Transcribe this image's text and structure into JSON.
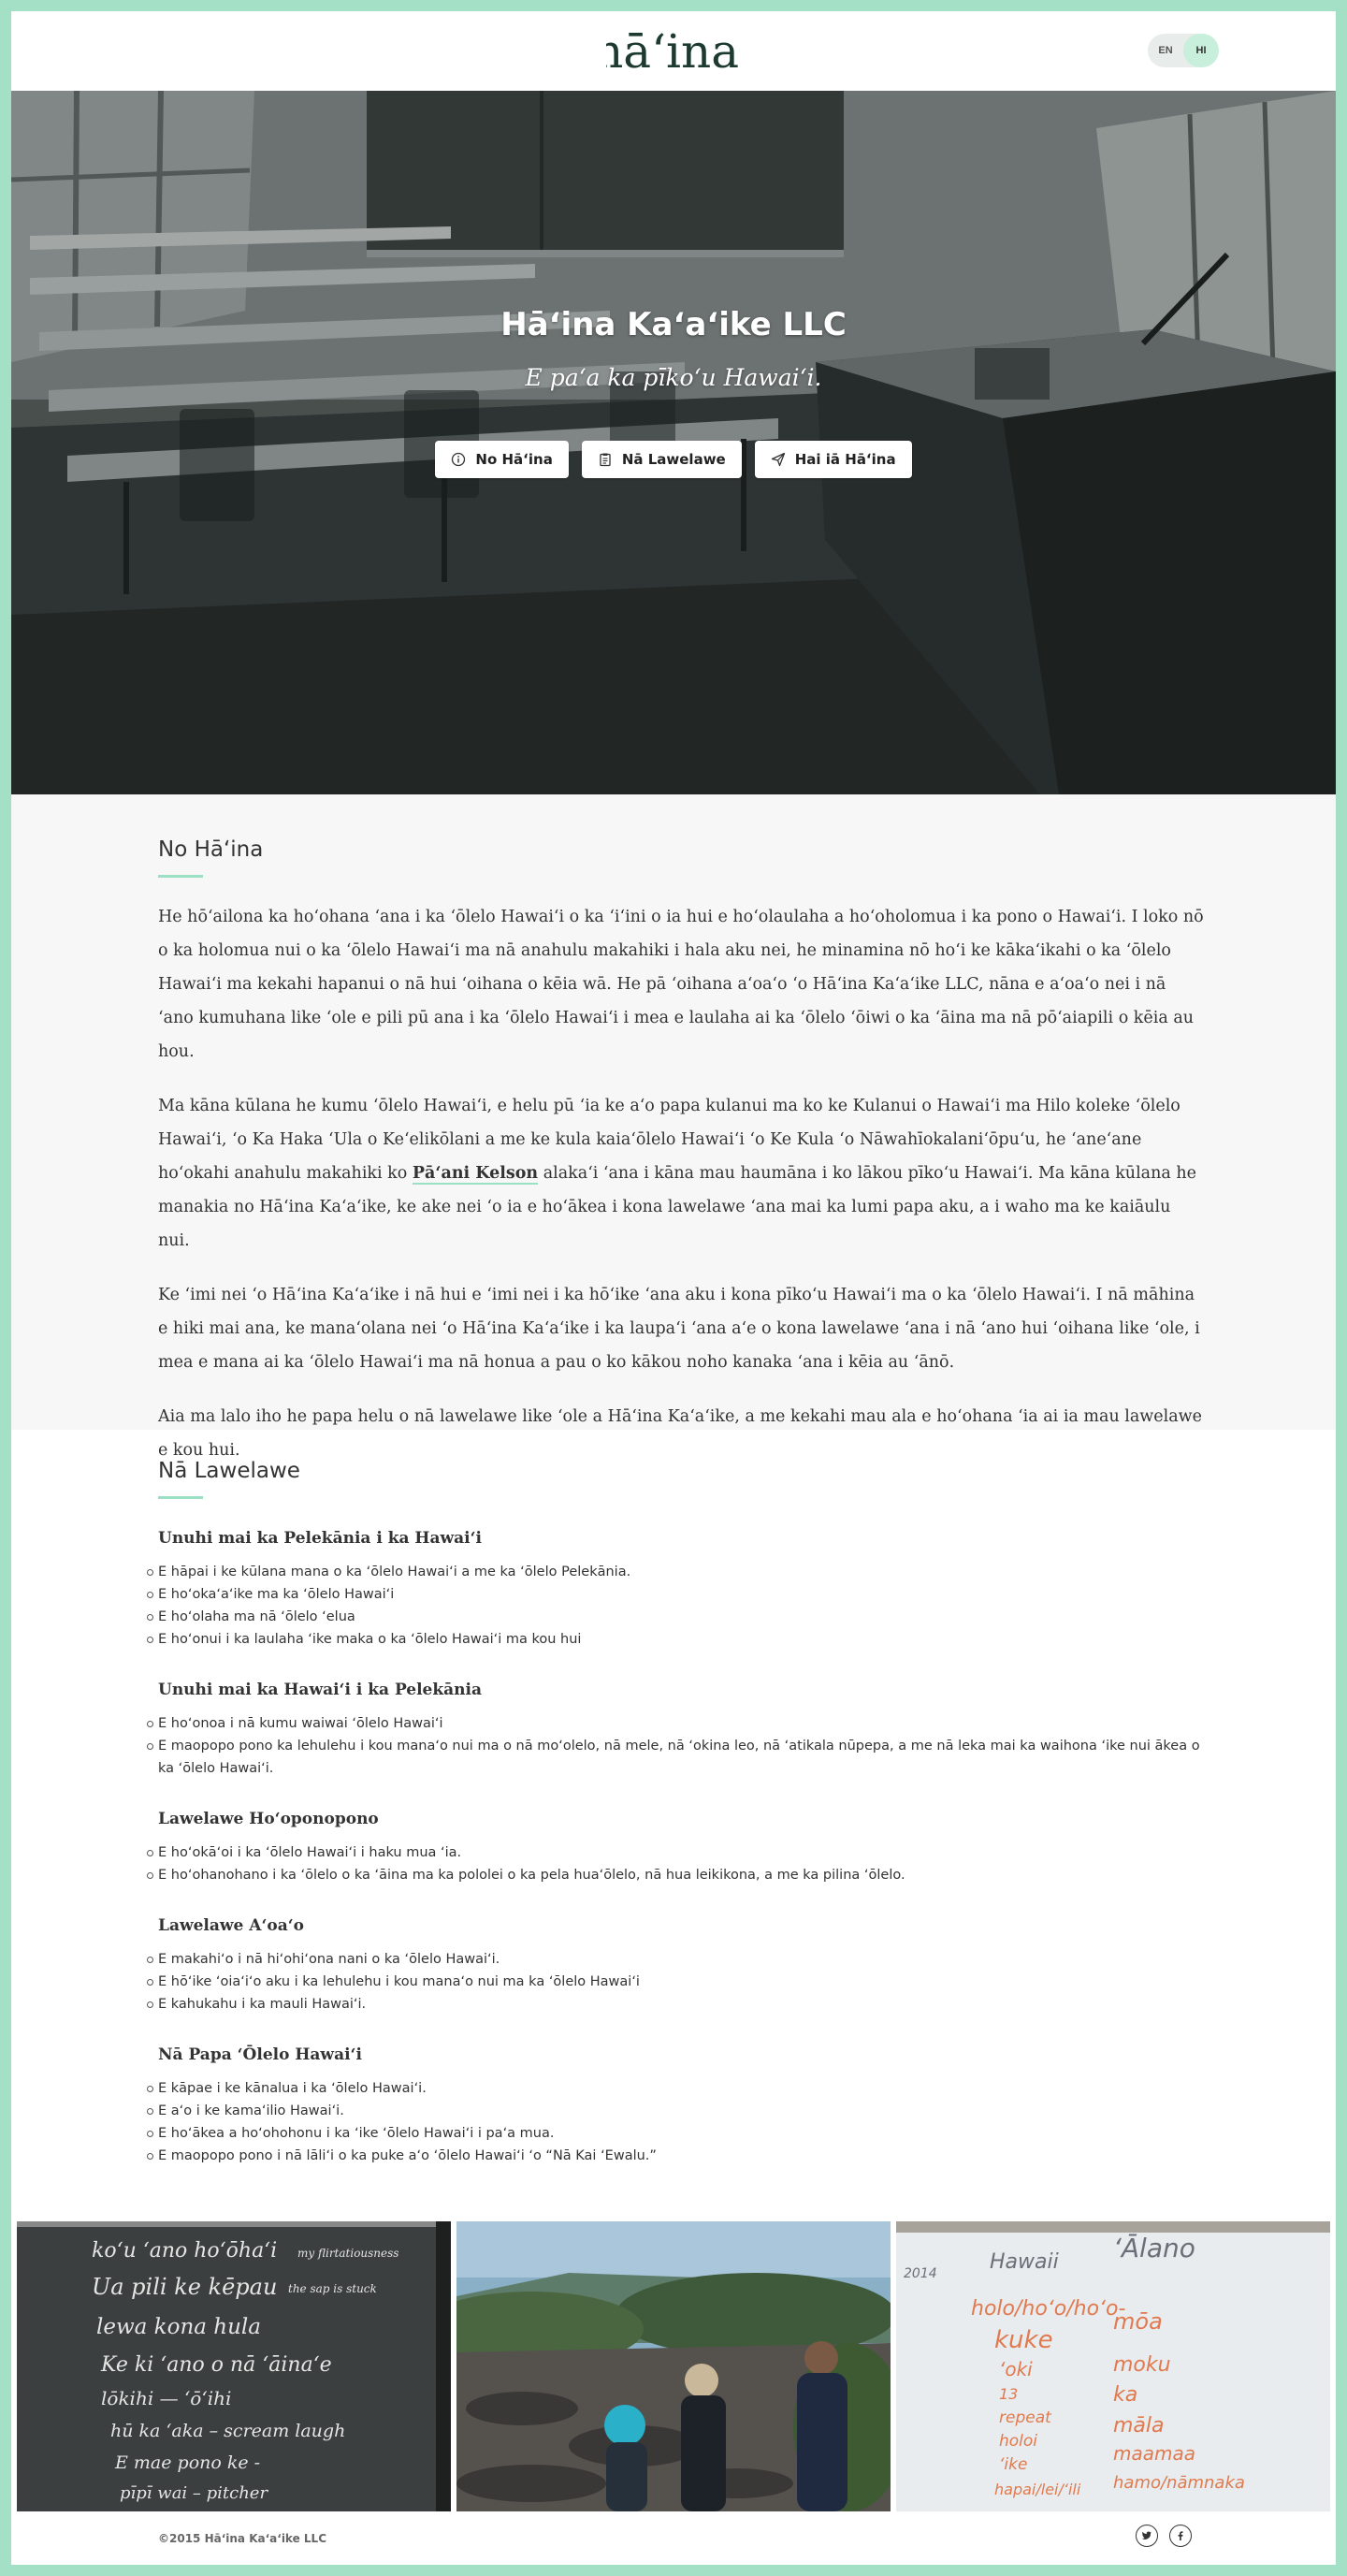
{
  "header": {
    "logo_text": "hāʻina.",
    "lang": {
      "en": "EN",
      "hi": "HI",
      "active": "HI"
    }
  },
  "hero": {
    "title": "Hāʻina Kaʻaʻike LLC",
    "subtitle": "E paʻa ka pīkoʻu Hawaiʻi.",
    "buttons": [
      {
        "label": "No Hāʻina",
        "icon": "info-icon"
      },
      {
        "label": "Nā Lawelawe",
        "icon": "clipboard-icon"
      },
      {
        "label": "Hai iā Hāʻina",
        "icon": "paper-plane-icon"
      }
    ]
  },
  "about": {
    "title": "No Hāʻina",
    "p1": "He hōʻailona ka hoʻohana ʻana i ka ʻōlelo Hawaiʻi o ka ʻiʻini o ia hui e hoʻolaulaha a hoʻoholomua i ka pono o Hawaiʻi. I loko nō o ka holomua nui o ka ʻōlelo Hawaiʻi ma nā anahulu makahiki i hala aku nei, he minamina nō hoʻi ke kākaʻikahi o ka ʻōlelo Hawaiʻi ma kekahi hapanui o nā hui ʻoihana o kēia wā. He pā ʻoihana aʻoaʻo ʻo Hāʻina Kaʻaʻike LLC, nāna e aʻoaʻo nei i nā ʻano kumuhana like ʻole e pili pū ana i ka ʻōlelo Hawaiʻi i mea e laulaha ai ka ʻōlelo ʻōiwi o ka ʻāina ma nā pōʻaiapili o kēia au hou.",
    "p2_before": "Ma kāna kūlana he kumu ʻōlelo Hawaiʻi, e helu pū ʻia ke aʻo papa kulanui ma ko ke Kulanui o Hawaiʻi ma Hilo koleke ʻōlelo Hawaiʻi, ʻo Ka Haka ʻUla o Keʻelikōlani a me ke kula kaiaʻōlelo Hawaiʻi ʻo Ke Kula ʻo Nāwahīokalaniʻōpuʻu, he ʻaneʻane hoʻokahi anahulu makahiki ko ",
    "p2_link": "Pāʻani Kelson",
    "p2_after": " alakaʻi ʻana i kāna mau haumāna i ko lākou pīkoʻu Hawaiʻi. Ma kāna kūlana he manakia no Hāʻina Kaʻaʻike, ke ake nei ʻo ia e hoʻākea i kona lawelawe ʻana mai ka lumi papa aku, a i waho ma ke kaiāulu nui.",
    "p3": "Ke ʻimi nei ʻo Hāʻina Kaʻaʻike i nā hui e ʻimi nei i ka hōʻike ʻana aku i kona pīkoʻu Hawaiʻi ma o ka ʻōlelo Hawaiʻi. I nā māhina e hiki mai ana, ke manaʻolana nei ʻo Hāʻina Kaʻaʻike i ka laupaʻi ʻana aʻe o kona lawelawe ʻana i nā ʻano hui ʻoihana like ʻole, i mea e mana ai ka ʻōlelo Hawaiʻi ma nā honua a pau o ko kākou noho kanaka ʻana i kēia au ʻānō.",
    "p4": "Aia ma lalo iho he papa helu o nā lawelawe like ʻole a Hāʻina Kaʻaʻike, a me kekahi mau ala e hoʻohana ʻia ai ia mau lawelawe e kou hui."
  },
  "services": {
    "title": "Nā Lawelawe",
    "groups": [
      {
        "title": "Unuhi mai ka Pelekānia i ka Hawaiʻi",
        "items": [
          "E hāpai i ke kūlana mana o ka ʻōlelo Hawaiʻi a me ka ʻōlelo Pelekānia.",
          "E hoʻokaʻaʻike ma ka ʻōlelo Hawaiʻi",
          "E hoʻolaha ma nā ʻōlelo ʻelua",
          "E hoʻonui i ka laulaha ʻike maka o ka ʻōlelo Hawaiʻi ma kou hui"
        ]
      },
      {
        "title": "Unuhi mai ka Hawaiʻi i ka Pelekānia",
        "items": [
          "E hoʻonoa i nā kumu waiwai ʻōlelo Hawaiʻi",
          "E maopopo pono ka lehulehu i kou manaʻo nui ma o nā moʻolelo, nā mele, nā ʻokina leo, nā ʻatikala nūpepa, a me nā leka mai ka waihona ʻike nui ākea o ka ʻōlelo Hawaiʻi."
        ]
      },
      {
        "title": "Lawelawe Hoʻoponopono",
        "items": [
          "E hoʻokāʻoi i ka ʻōlelo Hawaiʻi i haku mua ʻia.",
          "E hoʻohanohano i ka ʻōlelo o ka ʻāina ma ka pololei o ka pela huaʻōlelo, nā hua leikikona, a me ka pilina ʻōlelo."
        ]
      },
      {
        "title": "Lawelawe Aʻoaʻo",
        "items": [
          "E makahiʻo i nā hiʻohiʻona nani o ka ʻōlelo Hawaiʻi.",
          "E hōʻike ʻoiaʻiʻo aku i ka lehulehu i kou manaʻo nui ma ka ʻōlelo Hawaiʻi",
          "E kahukahu i ka mauli Hawaiʻi."
        ]
      },
      {
        "title": "Nā Papa ʻŌlelo Hawaiʻi",
        "items": [
          "E kāpae i ke kānalua i ka ʻōlelo Hawaiʻi.",
          "E aʻo i ke kamaʻilio Hawaiʻi.",
          "E hoʻākea a hoʻohohonu i ka ʻike ʻōlelo Hawaiʻi i paʻa mua.",
          "E maopopo pono i nā lāliʻi o ka puke aʻo ʻōlelo Hawaiʻi ʻo “Nā Kai ʻEwalu.”"
        ]
      }
    ]
  },
  "gallery": {
    "chalkboard_lines": [
      "koʻu ʻano hoʻōhaʻi",
      "my flirtatiousness",
      "Ua pili ke kēpau",
      "the sap is stuck",
      "lewa kona hula",
      "Ke ki ʻano o nā ʻāinaʻe",
      "lōkihi — ʻōʻihi",
      "hū ka ʻaka – scream laugh",
      "E mae pono ke -",
      "pīpī wai – pitcher"
    ],
    "whiteboard_left": [
      "2014",
      "Hawaii",
      "holo/hoʻo/hoʻo-",
      "kuke",
      "ʻoki",
      "13",
      "repeat",
      "holoi",
      "ʻike",
      "hapai/lei/ʻili"
    ],
    "whiteboard_right": [
      "ʻĀlano",
      "mōa",
      "moku",
      "ka",
      "māla",
      "maamaa",
      "hamo/nāmnaka"
    ]
  },
  "footer": {
    "copyright": "©2015 Hāʻina Kaʻaʻike LLC",
    "social": [
      "twitter-icon",
      "facebook-icon"
    ]
  },
  "colors": {
    "accent": "#9be0c2",
    "border": "#a3e0c5",
    "logo": "#1d3a30"
  }
}
